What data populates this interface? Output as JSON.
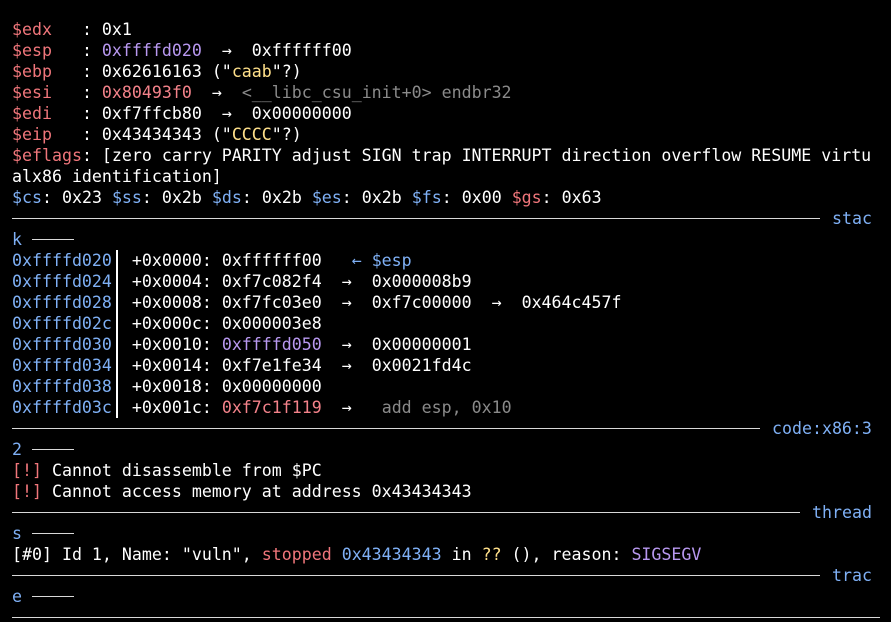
{
  "registers": [
    {
      "name": "$edx",
      "val": "0x1"
    },
    {
      "name": "$esp",
      "val": "0xffffd020",
      "arrow": "→",
      "target": "0xffffff00"
    },
    {
      "name": "$ebp",
      "val": "0x62616163",
      "note_pre": " (\"",
      "note": "caab",
      "note_post": "\"?)"
    },
    {
      "name": "$esi",
      "val": "0x80493f0",
      "arrow": "→",
      "sym": "<__libc_csu_init+0> endbr32"
    },
    {
      "name": "$edi",
      "val": "0xf7ffcb80",
      "arrow": "→",
      "target": "0x00000000"
    },
    {
      "name": "$eip",
      "val": "0x43434343",
      "note_pre": " (\"",
      "note": "CCCC",
      "note_post": "\"?)"
    }
  ],
  "eflags": {
    "name": "$eflags",
    "line1": "[zero carry PARITY adjust SIGN trap INTERRUPT direction overflow RESUME virtu",
    "line2": "alx86 identification]"
  },
  "segments": [
    {
      "name": "$cs",
      "val": "0x23"
    },
    {
      "name": "$ss",
      "val": "0x2b"
    },
    {
      "name": "$ds",
      "val": "0x2b"
    },
    {
      "name": "$es",
      "val": "0x2b"
    },
    {
      "name": "$fs",
      "val": "0x00"
    },
    {
      "name": "$gs",
      "val": "0x63"
    }
  ],
  "stack_header": {
    "part1": "stac",
    "part2": "k"
  },
  "stack": [
    {
      "addr": "0xffffd020",
      "off": "+0x0000:",
      "val": "0xffffff00",
      "tail": "   ← ",
      "reg": "$esp"
    },
    {
      "addr": "0xffffd024",
      "off": "+0x0004:",
      "val": "0xf7c082f4",
      "arrow": "→",
      "v2": "0x000008b9"
    },
    {
      "addr": "0xffffd028",
      "off": "+0x0008:",
      "val": "0xf7fc03e0",
      "arrow": "→",
      "v2": "0xf7c00000",
      "arrow2": "→",
      "v3": "0x464c457f"
    },
    {
      "addr": "0xffffd02c",
      "off": "+0x000c:",
      "val": "0x000003e8"
    },
    {
      "addr": "0xffffd030",
      "off": "+0x0010:",
      "val": "0xffffd050",
      "arrow": "→",
      "v2": "0x00000001"
    },
    {
      "addr": "0xffffd034",
      "off": "+0x0014:",
      "val": "0xf7e1fe34",
      "arrow": "→",
      "v2": "0x0021fd4c"
    },
    {
      "addr": "0xffffd038",
      "off": "+0x0018:",
      "val": "0x00000000"
    },
    {
      "addr": "0xffffd03c",
      "off": "+0x001c:",
      "val": "0xf7c1f119",
      "arrow": "→",
      "instr": "add esp, 0x10"
    }
  ],
  "code_header": {
    "part1": "code:x86:3",
    "part2": "2"
  },
  "code_msgs": [
    {
      "tag": "[!]",
      "text": " Cannot disassemble from $PC"
    },
    {
      "tag": "[!]",
      "text": " Cannot access memory at address 0x43434343"
    }
  ],
  "thread_header": {
    "part1": "thread",
    "part2": "s"
  },
  "thread": {
    "id": "[#0]",
    "pre": " Id 1, Name: \"vuln\", ",
    "state": "stopped",
    "addr": "0x43434343",
    "in": " in ",
    "func": "??",
    "post": " (), reason: ",
    "reason": "SIGSEGV"
  },
  "trace_header": {
    "part1": "trac",
    "part2": "e"
  }
}
